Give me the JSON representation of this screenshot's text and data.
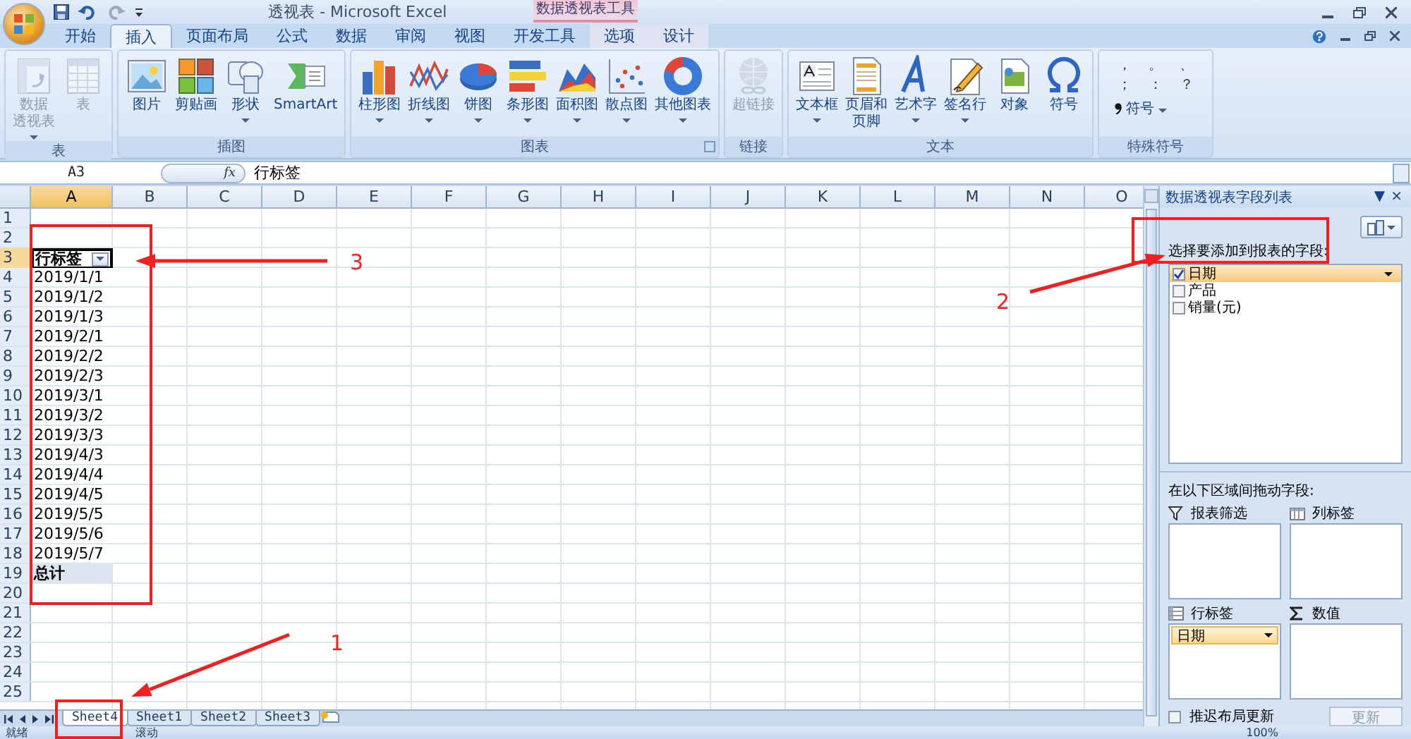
{
  "title_bar": {
    "title": "透视表 - Microsoft Excel",
    "contextual_title": "数据透视表工具"
  },
  "tabs": [
    {
      "label": "开始",
      "selected": false,
      "contextual": false
    },
    {
      "label": "插入",
      "selected": true,
      "contextual": false
    },
    {
      "label": "页面布局",
      "selected": false,
      "contextual": false
    },
    {
      "label": "公式",
      "selected": false,
      "contextual": false
    },
    {
      "label": "数据",
      "selected": false,
      "contextual": false
    },
    {
      "label": "审阅",
      "selected": false,
      "contextual": false
    },
    {
      "label": "视图",
      "selected": false,
      "contextual": false
    },
    {
      "label": "开发工具",
      "selected": false,
      "contextual": false
    },
    {
      "label": "选项",
      "selected": false,
      "contextual": true
    },
    {
      "label": "设计",
      "selected": false,
      "contextual": true
    }
  ],
  "ribbon_groups": [
    {
      "title": "表",
      "buttons": [
        {
          "lines": [
            "数据",
            "透视表"
          ],
          "dropdown": true,
          "disabled": true
        },
        {
          "lines": [
            "表"
          ],
          "dropdown": false,
          "disabled": true
        }
      ]
    },
    {
      "title": "插图",
      "buttons": [
        {
          "lines": [
            "图片"
          ],
          "dropdown": false,
          "disabled": false
        },
        {
          "lines": [
            "剪贴画"
          ],
          "dropdown": false,
          "disabled": false
        },
        {
          "lines": [
            "形状"
          ],
          "dropdown": true,
          "disabled": false
        },
        {
          "lines": [
            "SmartArt"
          ],
          "dropdown": false,
          "disabled": false
        }
      ]
    },
    {
      "title": "图表",
      "launcher": true,
      "buttons": [
        {
          "lines": [
            "柱形图"
          ],
          "dropdown": true,
          "disabled": false
        },
        {
          "lines": [
            "折线图"
          ],
          "dropdown": true,
          "disabled": false
        },
        {
          "lines": [
            "饼图"
          ],
          "dropdown": true,
          "disabled": false
        },
        {
          "lines": [
            "条形图"
          ],
          "dropdown": true,
          "disabled": false
        },
        {
          "lines": [
            "面积图"
          ],
          "dropdown": true,
          "disabled": false
        },
        {
          "lines": [
            "散点图"
          ],
          "dropdown": true,
          "disabled": false
        },
        {
          "lines": [
            "其他图表"
          ],
          "dropdown": true,
          "disabled": false
        }
      ]
    },
    {
      "title": "链接",
      "buttons": [
        {
          "lines": [
            "超链接"
          ],
          "dropdown": false,
          "disabled": true
        }
      ]
    },
    {
      "title": "文本",
      "buttons": [
        {
          "lines": [
            "文本框"
          ],
          "dropdown": true,
          "disabled": false
        },
        {
          "lines": [
            "页眉和",
            "页脚"
          ],
          "dropdown": false,
          "disabled": false
        },
        {
          "lines": [
            "艺术字"
          ],
          "dropdown": true,
          "disabled": false
        },
        {
          "lines": [
            "签名行"
          ],
          "dropdown": true,
          "disabled": false
        },
        {
          "lines": [
            "对象"
          ],
          "dropdown": false,
          "disabled": false
        },
        {
          "lines": [
            "符号"
          ],
          "dropdown": false,
          "disabled": false
        }
      ]
    },
    {
      "title": "特殊符号",
      "symbols": [
        "，",
        "。",
        "、",
        "；",
        "：",
        "？"
      ],
      "symbol_menu": {
        "label": "符号",
        "dropdown": true
      }
    }
  ],
  "formula_bar": {
    "name_box": "A3",
    "fx": "fx",
    "content": "行标签"
  },
  "columns": [
    {
      "label": "A",
      "selected": true
    },
    {
      "label": "B",
      "selected": false
    },
    {
      "label": "C",
      "selected": false
    },
    {
      "label": "D",
      "selected": false
    },
    {
      "label": "E",
      "selected": false
    },
    {
      "label": "F",
      "selected": false
    },
    {
      "label": "G",
      "selected": false
    },
    {
      "label": "H",
      "selected": false
    },
    {
      "label": "I",
      "selected": false
    },
    {
      "label": "J",
      "selected": false
    },
    {
      "label": "K",
      "selected": false
    },
    {
      "label": "L",
      "selected": false
    },
    {
      "label": "M",
      "selected": false
    },
    {
      "label": "N",
      "selected": false
    },
    {
      "label": "O",
      "selected": false
    }
  ],
  "rows": [
    {
      "header": "1",
      "selected": false
    },
    {
      "header": "2",
      "selected": false
    },
    {
      "header": "3",
      "selected": true,
      "kind": "pivot_header",
      "a": "行标签"
    },
    {
      "header": "4",
      "selected": false,
      "kind": "item",
      "a": "2019/1/1"
    },
    {
      "header": "5",
      "selected": false,
      "kind": "item",
      "a": "2019/1/2"
    },
    {
      "header": "6",
      "selected": false,
      "kind": "item",
      "a": "2019/1/3"
    },
    {
      "header": "7",
      "selected": false,
      "kind": "item",
      "a": "2019/2/1"
    },
    {
      "header": "8",
      "selected": false,
      "kind": "item",
      "a": "2019/2/2"
    },
    {
      "header": "9",
      "selected": false,
      "kind": "item",
      "a": "2019/2/3"
    },
    {
      "header": "10",
      "selected": false,
      "kind": "item",
      "a": "2019/3/1"
    },
    {
      "header": "11",
      "selected": false,
      "kind": "item",
      "a": "2019/3/2"
    },
    {
      "header": "12",
      "selected": false,
      "kind": "item",
      "a": "2019/3/3"
    },
    {
      "header": "13",
      "selected": false,
      "kind": "item",
      "a": "2019/4/3"
    },
    {
      "header": "14",
      "selected": false,
      "kind": "item",
      "a": "2019/4/4"
    },
    {
      "header": "15",
      "selected": false,
      "kind": "item",
      "a": "2019/4/5"
    },
    {
      "header": "16",
      "selected": false,
      "kind": "item",
      "a": "2019/5/5"
    },
    {
      "header": "17",
      "selected": false,
      "kind": "item",
      "a": "2019/5/6"
    },
    {
      "header": "18",
      "selected": false,
      "kind": "item",
      "a": "2019/5/7"
    },
    {
      "header": "19",
      "selected": false,
      "kind": "total",
      "a": "总计"
    },
    {
      "header": "20",
      "selected": false
    },
    {
      "header": "21",
      "selected": false
    },
    {
      "header": "22",
      "selected": false
    },
    {
      "header": "23",
      "selected": false
    },
    {
      "header": "24",
      "selected": false
    },
    {
      "header": "25",
      "selected": false
    }
  ],
  "sheet_tabs": [
    {
      "label": "Sheet4",
      "selected": true
    },
    {
      "label": "Sheet1",
      "selected": false
    },
    {
      "label": "Sheet2",
      "selected": false
    },
    {
      "label": "Sheet3",
      "selected": false
    }
  ],
  "field_list": {
    "title": "数据透视表字段列表",
    "menu_glyph": "▼",
    "close_glyph": "×",
    "choose_label": "选择要添加到报表的字段:",
    "fields": [
      {
        "label": "日期",
        "checked": true,
        "selected": true
      },
      {
        "label": "产品",
        "checked": false,
        "selected": false
      },
      {
        "label": "销量(元)",
        "checked": false,
        "selected": false
      }
    ],
    "drag_label": "在以下区域间拖动字段:",
    "areas": [
      {
        "title": "报表筛选",
        "kind": "filter"
      },
      {
        "title": "列标签",
        "kind": "columns"
      },
      {
        "title": "行标签",
        "kind": "rows",
        "items": [
          "日期"
        ]
      },
      {
        "title": "数值",
        "kind": "values"
      }
    ],
    "defer": {
      "label": "推迟布局更新",
      "checked": false
    },
    "update_button": {
      "label": "更新",
      "disabled": true
    }
  },
  "status_bar": {
    "items": [
      "就绪",
      "滚动"
    ],
    "zoom": "100%"
  },
  "annotations": [
    {
      "label": "3"
    },
    {
      "label": "2"
    },
    {
      "label": "1"
    }
  ]
}
